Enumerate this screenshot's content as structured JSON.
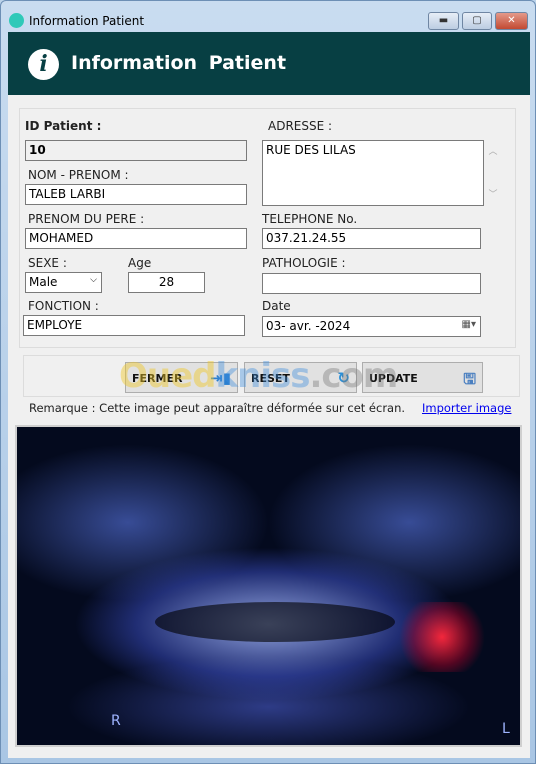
{
  "window": {
    "title": "Information  Patient",
    "minimize": "▬",
    "maximize": "▢",
    "close": "✕"
  },
  "header": {
    "title": "Information  Patient",
    "icon": "info-icon"
  },
  "form": {
    "id_label": "ID Patient  :",
    "id_value": "10",
    "nom_label": "NOM -  PRENOM  :",
    "nom_value": "TALEB LARBI",
    "pere_label": "PRENOM DU PERE :",
    "pere_value": "MOHAMED",
    "sexe_label": "SEXE  :",
    "sexe_value": "Male",
    "age_label": "Age",
    "age_value": "28",
    "fonction_label": "FONCTION  :",
    "fonction_value": "EMPLOYE",
    "adresse_label": "ADRESSE   :",
    "adresse_value": "RUE DES LILAS",
    "tel_label": "TELEPHONE  No.",
    "tel_value": "037.21.24.55",
    "patho_label": "PATHOLOGIE   :",
    "patho_value": "",
    "date_label": "Date",
    "date_value": "03- avr. -2024"
  },
  "buttons": {
    "fermer": "FERMER",
    "reset": "RESET",
    "update": "UPDATE"
  },
  "remarque": "Remarque : Cette image peut apparaître déformée sur cet écran.",
  "import_link": "Importer image",
  "xray": {
    "left_marker": "R",
    "right_marker": "L"
  },
  "watermark": "Ouedkniss.com",
  "colors": {
    "header": "#073f43",
    "link": "#0000ee"
  }
}
